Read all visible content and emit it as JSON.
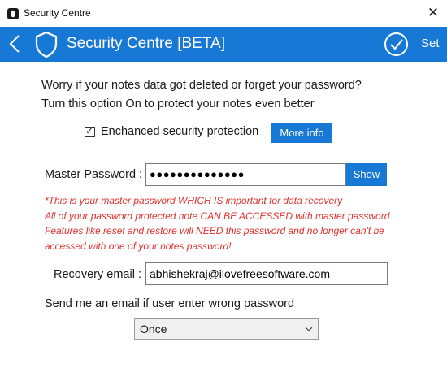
{
  "window": {
    "title": "Security Centre"
  },
  "header": {
    "title": "Security Centre [BETA]",
    "set_label": "Set"
  },
  "intro": {
    "line1": "Worry if your notes data got deleted or forget your password?",
    "line2": "Turn this option On to protect your notes even better"
  },
  "security_option": {
    "checkbox_label": "Enchanced security protection",
    "checked": true,
    "more_info_label": "More info"
  },
  "master_password": {
    "label": "Master Password :",
    "masked_value": "●●●●●●●●●●●●●●",
    "show_label": "Show"
  },
  "warning": {
    "line1": "*This is your master password WHICH IS important for data recovery",
    "line2": "All of your password protected note CAN BE ACCESSED with master password",
    "line3": "Features like reset and restore will NEED this password and no longer can't be",
    "line4": "accessed with one of your notes password!"
  },
  "recovery": {
    "label": "Recovery email :",
    "value": "abhishekraj@ilovefreesoftware.com"
  },
  "notify": {
    "label": "Send me an email if user enter wrong password",
    "selected": "Once"
  },
  "colors": {
    "accent": "#1878d6",
    "warning": "#e0302b"
  },
  "icons": {
    "app": "app-logo-icon",
    "close": "close-icon",
    "back": "back-arrow-icon",
    "shield": "shield-icon",
    "confirm": "check-circle-icon",
    "dropdown": "chevron-down-icon"
  }
}
